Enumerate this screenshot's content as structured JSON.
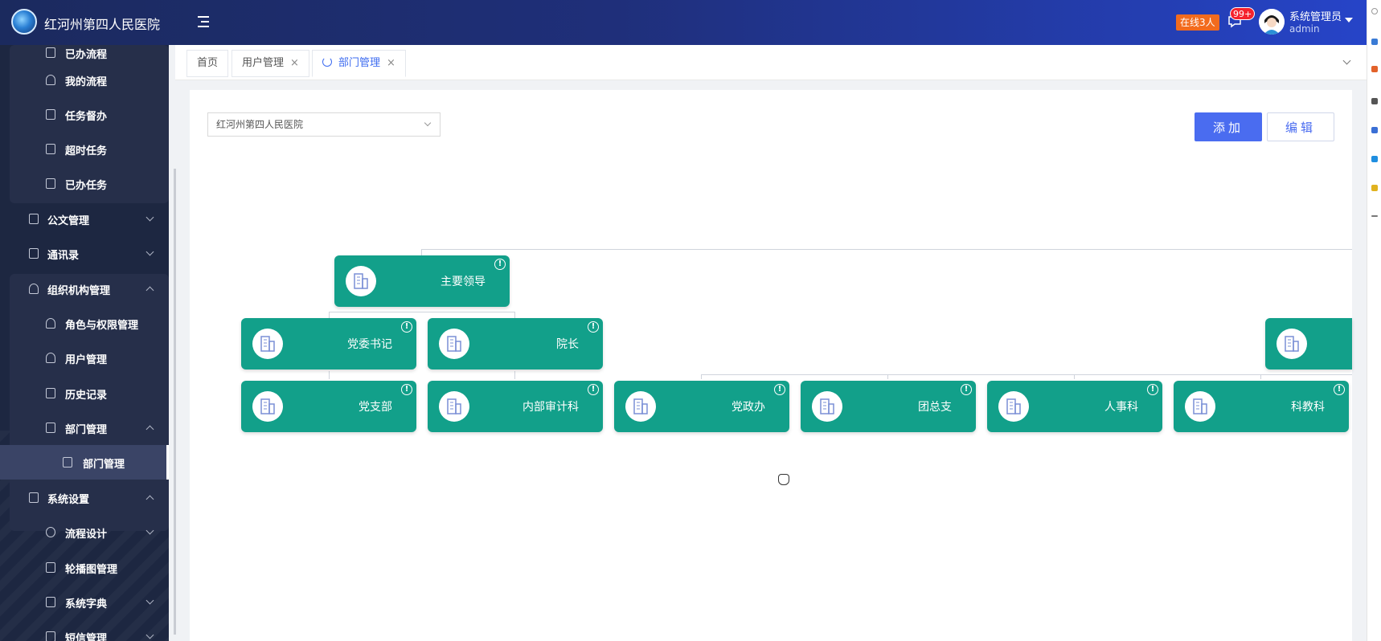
{
  "header": {
    "app_title": "红河州第四人民医院",
    "online_label": "在线3人",
    "notif_count": "99+",
    "user_name": "系统管理员",
    "user_login": "admin",
    "colors": {
      "header_from": "#1b2a5e",
      "header_to": "#2644c8",
      "online_badge": "#f26b1d",
      "notif_badge": "#f5222d"
    }
  },
  "sidebar": {
    "items": [
      {
        "label": "已办流程",
        "icon": "doc-icon"
      },
      {
        "label": "我的流程",
        "icon": "user-icon"
      },
      {
        "label": "任务督办",
        "icon": "list-icon"
      },
      {
        "label": "超时任务",
        "icon": "clock-doc-icon"
      },
      {
        "label": "已办任务",
        "icon": "calendar-icon"
      },
      {
        "label": "公文管理",
        "icon": "file-icon"
      },
      {
        "label": "通讯录",
        "icon": "phone-icon"
      },
      {
        "label": "组织机构管理",
        "icon": "user-icon"
      },
      {
        "label": "角色与权限管理",
        "icon": "role-icon"
      },
      {
        "label": "用户管理",
        "icon": "user-icon"
      },
      {
        "label": "历史记录",
        "icon": "history-icon"
      },
      {
        "label": "部门管理",
        "icon": "org-icon"
      },
      {
        "label": "部门管理",
        "icon": "org-icon"
      },
      {
        "label": "系统设置",
        "icon": "monitor-icon"
      },
      {
        "label": "流程设计",
        "icon": "flow-icon"
      },
      {
        "label": "轮播图管理",
        "icon": "image-icon"
      },
      {
        "label": "系统字典",
        "icon": "book-icon"
      },
      {
        "label": "短信管理",
        "icon": "message-icon"
      }
    ],
    "colors": {
      "bg": "#1d2741",
      "panel": "#262f4a",
      "active": "#3a4466"
    }
  },
  "tabs": [
    {
      "label": "首页",
      "closable": false
    },
    {
      "label": "用户管理",
      "closable": true
    },
    {
      "label": "部门管理",
      "closable": true,
      "active": true
    }
  ],
  "tab_close_glyph": "×",
  "toolbar": {
    "select_value": "红河州第四人民医院",
    "add_label": "添加",
    "edit_label": "编辑",
    "accent": "#4a6cf0"
  },
  "org_chart": {
    "node_color": "#12a08a",
    "info_glyph": "!",
    "root": "主要领导",
    "level2": [
      "党委书记",
      "院长"
    ],
    "level3": [
      "党支部",
      "内部审计科",
      "党政办",
      "团总支",
      "人事科",
      "科教科"
    ]
  }
}
